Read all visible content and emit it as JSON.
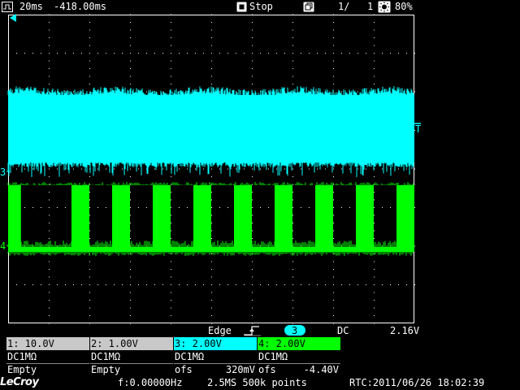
{
  "topbar": {
    "timebase": "20ms",
    "delay": "-418.00ms",
    "run_state": "Stop",
    "acq_count": "1/",
    "acq_total": "1",
    "battery": "80%"
  },
  "markers": {
    "trigger_level_label": "T",
    "ch3_label": "3",
    "ch4_label": "4"
  },
  "trigger": {
    "type": "Edge",
    "source": "3",
    "coupling": "DC",
    "level": "2.16V"
  },
  "channels": [
    {
      "header": "1: 10.0V",
      "coupling": "DC1MΩ",
      "status": "Empty",
      "ofs_label": "",
      "ofs_value": ""
    },
    {
      "header": "2: 1.00V",
      "coupling": "DC1MΩ",
      "status": "Empty",
      "ofs_label": "",
      "ofs_value": ""
    },
    {
      "header": "3: 2.00V",
      "coupling": "DC1MΩ",
      "status": "",
      "ofs_label": "ofs",
      "ofs_value": "320mV"
    },
    {
      "header": "4: 2.00V",
      "coupling": "DC1MΩ",
      "status": "",
      "ofs_label": "ofs",
      "ofs_value": "-4.40V"
    }
  ],
  "bottombar": {
    "brand": "LeCroy",
    "frequency": "f:0.00000Hz",
    "sample_rate": "2.5MS 500k points",
    "rtc": "RTC:2011/06/26 18:02:39"
  },
  "colors": {
    "ch1": "#c8c8c8",
    "ch2": "#c8c8c8",
    "ch3": "#00ffff",
    "ch4": "#00ff00",
    "grid": "#ffffff"
  },
  "waveform": {
    "ch4_pulse_count": 10,
    "ch4_duty": 0.44
  }
}
